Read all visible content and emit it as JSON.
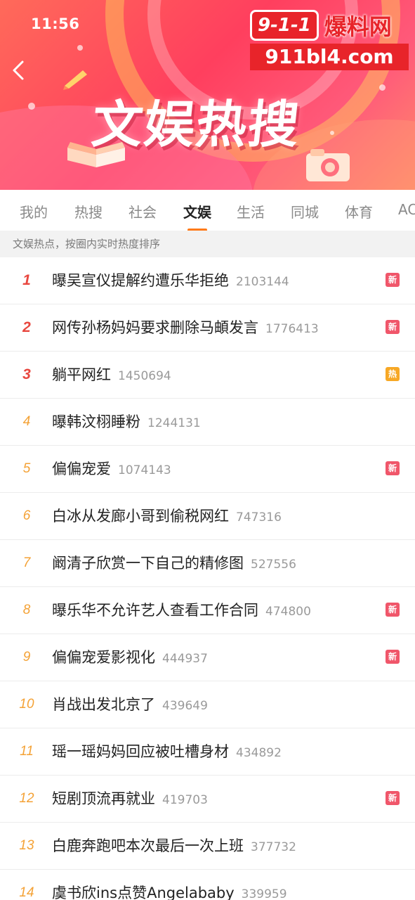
{
  "status_bar": {
    "time": "11:56"
  },
  "watermark": {
    "logo": "9-1-1",
    "title": "爆料网",
    "url": "911bl4.com"
  },
  "banner": {
    "title": "文娱热搜"
  },
  "tabs": [
    {
      "label": "我的",
      "active": false
    },
    {
      "label": "热搜",
      "active": false
    },
    {
      "label": "社会",
      "active": false
    },
    {
      "label": "文娱",
      "active": true
    },
    {
      "label": "生活",
      "active": false
    },
    {
      "label": "同城",
      "active": false
    },
    {
      "label": "体育",
      "active": false
    },
    {
      "label": "AC",
      "active": false
    }
  ],
  "notice": "文娱热点，按圈内实时热度排序",
  "colors": {
    "badge_new": "#f0566a",
    "badge_hot": "#f7a825",
    "tab_underline": "#ff7a1a",
    "rank_top": "#e8473f",
    "rank_other": "#f4a236"
  },
  "items": [
    {
      "rank": "1",
      "title": "曝吴宣仪提解约遭乐华拒绝",
      "count": "2103144",
      "badge": "新"
    },
    {
      "rank": "2",
      "title": "网传孙杨妈妈要求删除马頔发言",
      "count": "1776413",
      "badge": "新"
    },
    {
      "rank": "3",
      "title": "躺平网红",
      "count": "1450694",
      "badge": "热"
    },
    {
      "rank": "4",
      "title": "曝韩汶栩睡粉",
      "count": "1244131",
      "badge": ""
    },
    {
      "rank": "5",
      "title": "偏偏宠爱",
      "count": "1074143",
      "badge": "新"
    },
    {
      "rank": "6",
      "title": "白冰从发廊小哥到偷税网红",
      "count": "747316",
      "badge": ""
    },
    {
      "rank": "7",
      "title": "阚清子欣赏一下自己的精修图",
      "count": "527556",
      "badge": ""
    },
    {
      "rank": "8",
      "title": "曝乐华不允许艺人查看工作合同",
      "count": "474800",
      "badge": "新"
    },
    {
      "rank": "9",
      "title": "偏偏宠爱影视化",
      "count": "444937",
      "badge": "新"
    },
    {
      "rank": "10",
      "title": "肖战出发北京了",
      "count": "439649",
      "badge": ""
    },
    {
      "rank": "11",
      "title": "瑶一瑶妈妈回应被吐槽身材",
      "count": "434892",
      "badge": ""
    },
    {
      "rank": "12",
      "title": "短剧顶流再就业",
      "count": "419703",
      "badge": "新"
    },
    {
      "rank": "13",
      "title": "白鹿奔跑吧本次最后一次上班",
      "count": "377732",
      "badge": ""
    },
    {
      "rank": "14",
      "title": "虞书欣ins点赞Angelababy",
      "count": "339959",
      "badge": ""
    }
  ]
}
